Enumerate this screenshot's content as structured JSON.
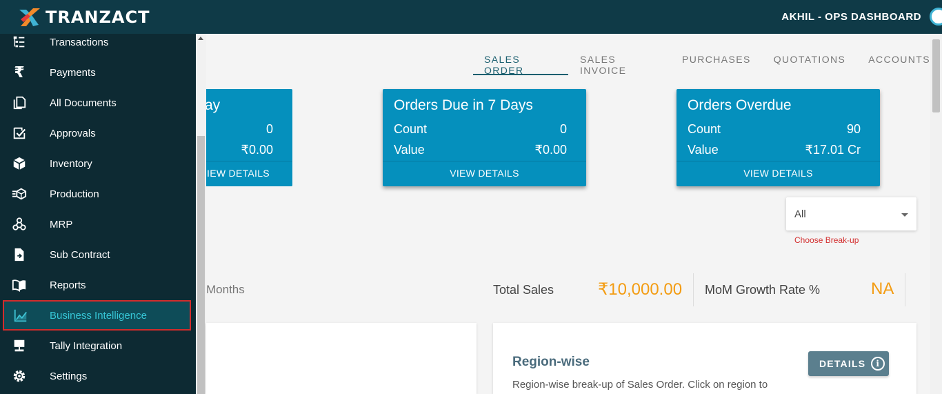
{
  "header": {
    "brand": "TRANZACT",
    "user_label": "AKHIL - OPS DASHBOARD"
  },
  "sidebar": {
    "items": [
      {
        "label": "Transactions",
        "icon": "transactions-icon"
      },
      {
        "label": "Payments",
        "icon": "rupee-icon"
      },
      {
        "label": "All Documents",
        "icon": "documents-icon"
      },
      {
        "label": "Approvals",
        "icon": "approvals-icon"
      },
      {
        "label": "Inventory",
        "icon": "inventory-icon"
      },
      {
        "label": "Production",
        "icon": "production-icon"
      },
      {
        "label": "MRP",
        "icon": "mrp-icon"
      },
      {
        "label": "Sub Contract",
        "icon": "subcontract-icon"
      },
      {
        "label": "Reports",
        "icon": "reports-icon"
      },
      {
        "label": "Business Intelligence",
        "icon": "chart-icon",
        "active": true
      },
      {
        "label": "Tally Integration",
        "icon": "tally-icon"
      },
      {
        "label": "Settings",
        "icon": "gear-icon"
      }
    ]
  },
  "tabs": [
    {
      "label": "SALES ORDER",
      "active": true
    },
    {
      "label": "SALES INVOICE"
    },
    {
      "label": "PURCHASES"
    },
    {
      "label": "QUOTATIONS"
    },
    {
      "label": "ACCOUNTS"
    }
  ],
  "cards": [
    {
      "title": "ay",
      "count_label": "",
      "count": "0",
      "value_label": "",
      "value": "₹0.00",
      "action": "IEW DETAILS"
    },
    {
      "title": "Orders Due in 7 Days",
      "count_label": "Count",
      "count": "0",
      "value_label": "Value",
      "value": "₹0.00",
      "action": "VIEW DETAILS"
    },
    {
      "title": "Orders Overdue",
      "count_label": "Count",
      "count": "90",
      "value_label": "Value",
      "value": "₹17.01 Cr",
      "action": "VIEW DETAILS"
    }
  ],
  "breakup": {
    "selected": "All",
    "hint": "Choose Break-up"
  },
  "stats": {
    "period_label": "Months",
    "total_sales_label": "Total Sales",
    "total_sales_value": "₹10,000.00",
    "growth_label": "MoM Growth Rate %",
    "growth_value": "NA"
  },
  "region_panel": {
    "title": "Region-wise",
    "description": "Region-wise break-up of Sales Order. Click on region to",
    "details_label": "DETAILS"
  },
  "colors": {
    "topbar": "#0f3a47",
    "sidebar": "#0d2a33",
    "card": "#0590bd",
    "accent_orange": "#f39c12",
    "active_item_border": "#d22c2c"
  }
}
